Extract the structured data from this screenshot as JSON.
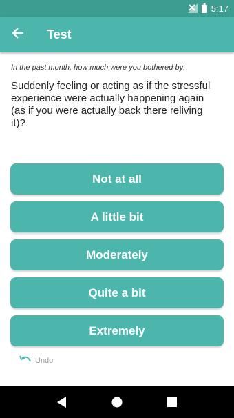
{
  "status_bar": {
    "time": "5:17"
  },
  "header": {
    "title": "Test"
  },
  "question": {
    "prompt": "In the past month, how much were you bothered by:",
    "text": "Suddenly feeling or acting as if the stressful experience were actually happening again (as if you were actually back there reliving it)?"
  },
  "answers": [
    "Not at all",
    "A little bit",
    "Moderately",
    "Quite a bit",
    "Extremely"
  ],
  "undo_label": "Undo",
  "colors": {
    "primary": "#4db6ac",
    "status_bar": "#3c9d90"
  },
  "icons": {
    "back": "arrow-back-icon",
    "undo": "undo-icon",
    "nav_back": "nav-back-icon",
    "nav_home": "nav-home-icon",
    "nav_recent": "nav-recents-icon"
  }
}
